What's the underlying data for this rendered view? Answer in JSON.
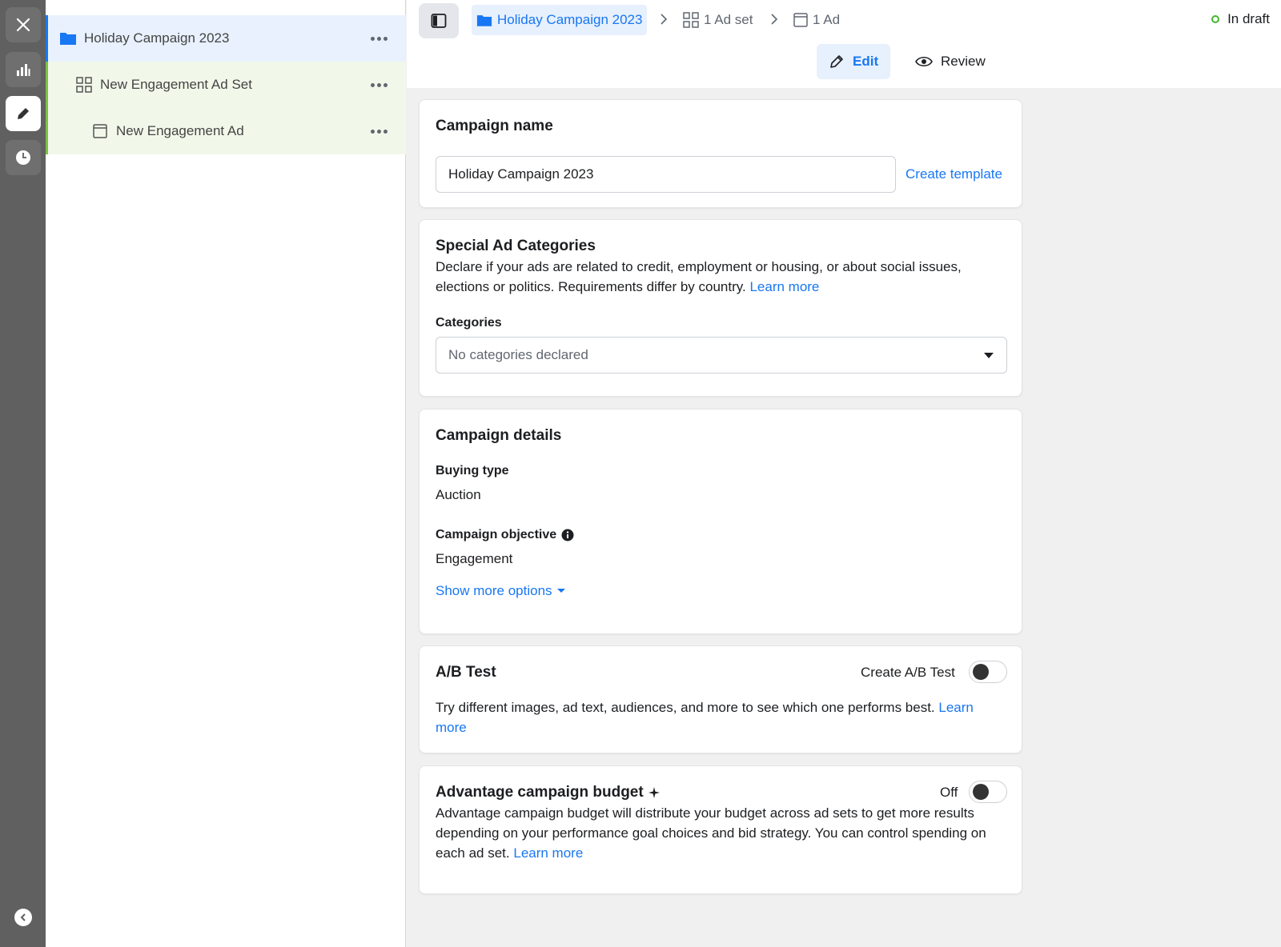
{
  "rail": {
    "items": [
      {
        "name": "close"
      },
      {
        "name": "reporting"
      },
      {
        "name": "edit"
      },
      {
        "name": "history"
      }
    ]
  },
  "tree": {
    "campaign": {
      "label": "Holiday Campaign 2023"
    },
    "adset": {
      "label": "New Engagement Ad Set"
    },
    "ad": {
      "label": "New Engagement Ad"
    }
  },
  "header": {
    "breadcrumb": {
      "campaign": "Holiday Campaign 2023",
      "adset": "1 Ad set",
      "ad": "1 Ad"
    },
    "status": "In draft",
    "tabs": {
      "edit": "Edit",
      "review": "Review"
    }
  },
  "campaign_name": {
    "title": "Campaign name",
    "value": "Holiday Campaign 2023",
    "create_template": "Create template"
  },
  "special_ad": {
    "title": "Special Ad Categories",
    "desc_line1": "Declare if your ads are related to credit, employment or housing, or about social issues,",
    "desc_line2": "elections or politics. Requirements differ by country.",
    "learn_more": "Learn more",
    "categories_label": "Categories",
    "categories_value": "No categories declared"
  },
  "details": {
    "title": "Campaign details",
    "buying_type_label": "Buying type",
    "buying_type_value": "Auction",
    "objective_label": "Campaign objective",
    "objective_value": "Engagement",
    "show_more": "Show more options"
  },
  "ab_test": {
    "title": "A/B Test",
    "toggle_label": "Create A/B Test",
    "desc": "Try different images, ad text, audiences, and more to see which one performs best.",
    "learn": "Learn",
    "more": "more"
  },
  "advantage": {
    "title": "Advantage campaign budget",
    "toggle_label": "Off",
    "line1": "Advantage campaign budget will distribute your budget across ad sets to get more results",
    "line2": "depending on your performance goal choices and bid strategy. You can control spending on",
    "line3": "each ad set.",
    "learn_more": "Learn more"
  },
  "colors": {
    "accent": "#1877f2",
    "status_green": "#42b72a",
    "rail": "#606060"
  }
}
